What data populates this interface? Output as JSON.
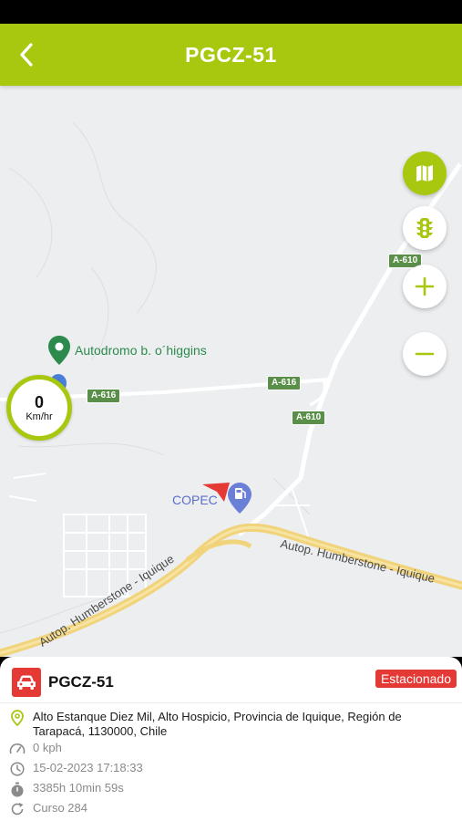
{
  "header": {
    "title": "PGCZ-51"
  },
  "map": {
    "poi_name": "Autodromo b. o´higgins",
    "station_name": "COPEC",
    "road_shields": [
      "A-610",
      "A-616",
      "A-616",
      "A-610"
    ],
    "road_names": [
      "Autop. Humberstone - Iquique",
      "Autop. Humberstone - Iquique"
    ],
    "speed": {
      "value": "0",
      "unit": "Km/hr"
    }
  },
  "panel": {
    "vehicle": "PGCZ-51",
    "status": "Estacionado",
    "address": "Alto Estanque Diez Mil, Alto Hospicio, Provincia de Iquique, Región de Tarapacá, 1130000, Chile",
    "speed": "0 kph",
    "timestamp": "15-02-2023 17:18:33",
    "duration": "3385h 10min 59s",
    "course": "Curso 284"
  },
  "colors": {
    "accent": "#a7c80f",
    "status_red": "#e53935",
    "poi_green": "#2c8a4d"
  }
}
